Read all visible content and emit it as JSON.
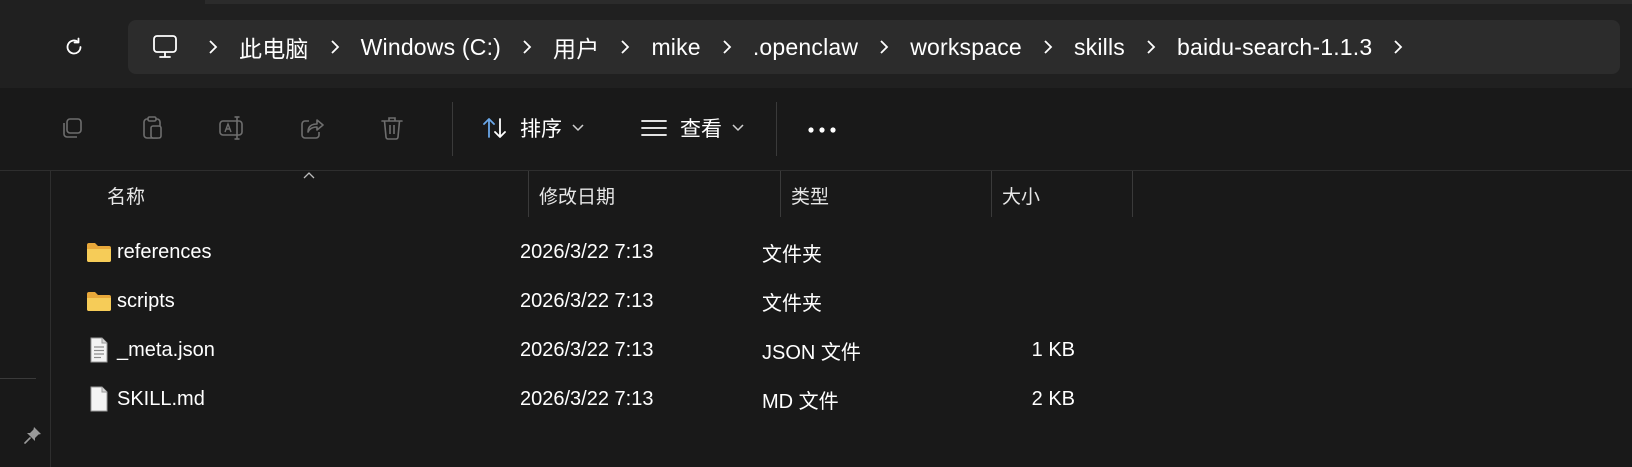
{
  "address_bar": {
    "breadcrumbs": [
      "此电脑",
      "Windows (C:)",
      "用户",
      "mike",
      ".openclaw",
      "workspace",
      "skills",
      "baidu-search-1.1.3"
    ]
  },
  "toolbar": {
    "sort_label": "排序",
    "view_label": "查看",
    "more_label": "···"
  },
  "columns": {
    "name": "名称",
    "modified": "修改日期",
    "type": "类型",
    "size": "大小"
  },
  "files": [
    {
      "name": "references",
      "modified": "2026/3/22 7:13",
      "type": "文件夹",
      "size": "",
      "icon": "folder-icon"
    },
    {
      "name": "scripts",
      "modified": "2026/3/22 7:13",
      "type": "文件夹",
      "size": "",
      "icon": "folder-icon"
    },
    {
      "name": "_meta.json",
      "modified": "2026/3/22 7:13",
      "type": "JSON 文件",
      "size": "1 KB",
      "icon": "json-file-icon"
    },
    {
      "name": "SKILL.md",
      "modified": "2026/3/22 7:13",
      "type": "MD 文件",
      "size": "2 KB",
      "icon": "md-file-icon"
    }
  ],
  "colors": {
    "background": "#191919",
    "address_box": "#2c2c2c",
    "folder_yellow": "#f2c24f",
    "sort_icon_blue": "#6aa7e8"
  }
}
